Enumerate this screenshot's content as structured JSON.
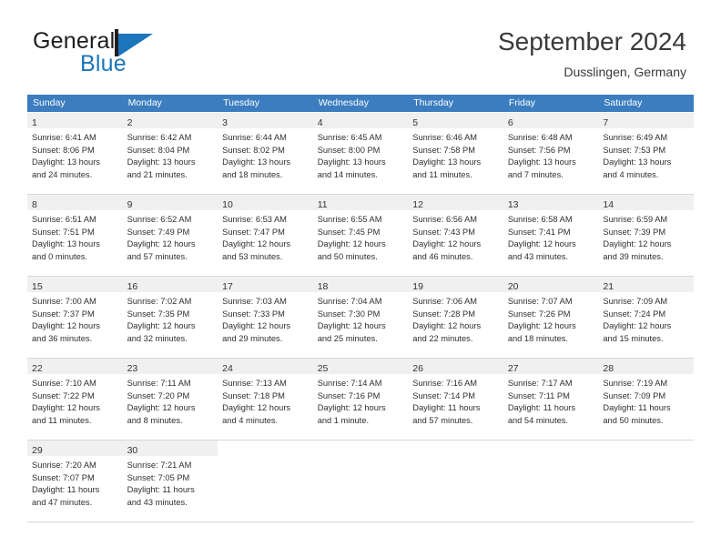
{
  "brand": {
    "name_part1": "General",
    "name_part2": "Blue",
    "mark": "triangle-logo"
  },
  "header": {
    "title": "September 2024",
    "subtitle": "Dusslingen, Germany"
  },
  "colors": {
    "header_blue": "#3b7dbf",
    "brand_blue": "#1b75bb",
    "daynum_band": "#f0f0f0",
    "row_border": "#d7d7d7"
  },
  "weekdays": [
    "Sunday",
    "Monday",
    "Tuesday",
    "Wednesday",
    "Thursday",
    "Friday",
    "Saturday"
  ],
  "weeks": [
    [
      {
        "day": "1",
        "sunrise": "Sunrise: 6:41 AM",
        "sunset": "Sunset: 8:06 PM",
        "daylight1": "Daylight: 13 hours",
        "daylight2": "and 24 minutes."
      },
      {
        "day": "2",
        "sunrise": "Sunrise: 6:42 AM",
        "sunset": "Sunset: 8:04 PM",
        "daylight1": "Daylight: 13 hours",
        "daylight2": "and 21 minutes."
      },
      {
        "day": "3",
        "sunrise": "Sunrise: 6:44 AM",
        "sunset": "Sunset: 8:02 PM",
        "daylight1": "Daylight: 13 hours",
        "daylight2": "and 18 minutes."
      },
      {
        "day": "4",
        "sunrise": "Sunrise: 6:45 AM",
        "sunset": "Sunset: 8:00 PM",
        "daylight1": "Daylight: 13 hours",
        "daylight2": "and 14 minutes."
      },
      {
        "day": "5",
        "sunrise": "Sunrise: 6:46 AM",
        "sunset": "Sunset: 7:58 PM",
        "daylight1": "Daylight: 13 hours",
        "daylight2": "and 11 minutes."
      },
      {
        "day": "6",
        "sunrise": "Sunrise: 6:48 AM",
        "sunset": "Sunset: 7:56 PM",
        "daylight1": "Daylight: 13 hours",
        "daylight2": "and 7 minutes."
      },
      {
        "day": "7",
        "sunrise": "Sunrise: 6:49 AM",
        "sunset": "Sunset: 7:53 PM",
        "daylight1": "Daylight: 13 hours",
        "daylight2": "and 4 minutes."
      }
    ],
    [
      {
        "day": "8",
        "sunrise": "Sunrise: 6:51 AM",
        "sunset": "Sunset: 7:51 PM",
        "daylight1": "Daylight: 13 hours",
        "daylight2": "and 0 minutes."
      },
      {
        "day": "9",
        "sunrise": "Sunrise: 6:52 AM",
        "sunset": "Sunset: 7:49 PM",
        "daylight1": "Daylight: 12 hours",
        "daylight2": "and 57 minutes."
      },
      {
        "day": "10",
        "sunrise": "Sunrise: 6:53 AM",
        "sunset": "Sunset: 7:47 PM",
        "daylight1": "Daylight: 12 hours",
        "daylight2": "and 53 minutes."
      },
      {
        "day": "11",
        "sunrise": "Sunrise: 6:55 AM",
        "sunset": "Sunset: 7:45 PM",
        "daylight1": "Daylight: 12 hours",
        "daylight2": "and 50 minutes."
      },
      {
        "day": "12",
        "sunrise": "Sunrise: 6:56 AM",
        "sunset": "Sunset: 7:43 PM",
        "daylight1": "Daylight: 12 hours",
        "daylight2": "and 46 minutes."
      },
      {
        "day": "13",
        "sunrise": "Sunrise: 6:58 AM",
        "sunset": "Sunset: 7:41 PM",
        "daylight1": "Daylight: 12 hours",
        "daylight2": "and 43 minutes."
      },
      {
        "day": "14",
        "sunrise": "Sunrise: 6:59 AM",
        "sunset": "Sunset: 7:39 PM",
        "daylight1": "Daylight: 12 hours",
        "daylight2": "and 39 minutes."
      }
    ],
    [
      {
        "day": "15",
        "sunrise": "Sunrise: 7:00 AM",
        "sunset": "Sunset: 7:37 PM",
        "daylight1": "Daylight: 12 hours",
        "daylight2": "and 36 minutes."
      },
      {
        "day": "16",
        "sunrise": "Sunrise: 7:02 AM",
        "sunset": "Sunset: 7:35 PM",
        "daylight1": "Daylight: 12 hours",
        "daylight2": "and 32 minutes."
      },
      {
        "day": "17",
        "sunrise": "Sunrise: 7:03 AM",
        "sunset": "Sunset: 7:33 PM",
        "daylight1": "Daylight: 12 hours",
        "daylight2": "and 29 minutes."
      },
      {
        "day": "18",
        "sunrise": "Sunrise: 7:04 AM",
        "sunset": "Sunset: 7:30 PM",
        "daylight1": "Daylight: 12 hours",
        "daylight2": "and 25 minutes."
      },
      {
        "day": "19",
        "sunrise": "Sunrise: 7:06 AM",
        "sunset": "Sunset: 7:28 PM",
        "daylight1": "Daylight: 12 hours",
        "daylight2": "and 22 minutes."
      },
      {
        "day": "20",
        "sunrise": "Sunrise: 7:07 AM",
        "sunset": "Sunset: 7:26 PM",
        "daylight1": "Daylight: 12 hours",
        "daylight2": "and 18 minutes."
      },
      {
        "day": "21",
        "sunrise": "Sunrise: 7:09 AM",
        "sunset": "Sunset: 7:24 PM",
        "daylight1": "Daylight: 12 hours",
        "daylight2": "and 15 minutes."
      }
    ],
    [
      {
        "day": "22",
        "sunrise": "Sunrise: 7:10 AM",
        "sunset": "Sunset: 7:22 PM",
        "daylight1": "Daylight: 12 hours",
        "daylight2": "and 11 minutes."
      },
      {
        "day": "23",
        "sunrise": "Sunrise: 7:11 AM",
        "sunset": "Sunset: 7:20 PM",
        "daylight1": "Daylight: 12 hours",
        "daylight2": "and 8 minutes."
      },
      {
        "day": "24",
        "sunrise": "Sunrise: 7:13 AM",
        "sunset": "Sunset: 7:18 PM",
        "daylight1": "Daylight: 12 hours",
        "daylight2": "and 4 minutes."
      },
      {
        "day": "25",
        "sunrise": "Sunrise: 7:14 AM",
        "sunset": "Sunset: 7:16 PM",
        "daylight1": "Daylight: 12 hours",
        "daylight2": "and 1 minute."
      },
      {
        "day": "26",
        "sunrise": "Sunrise: 7:16 AM",
        "sunset": "Sunset: 7:14 PM",
        "daylight1": "Daylight: 11 hours",
        "daylight2": "and 57 minutes."
      },
      {
        "day": "27",
        "sunrise": "Sunrise: 7:17 AM",
        "sunset": "Sunset: 7:11 PM",
        "daylight1": "Daylight: 11 hours",
        "daylight2": "and 54 minutes."
      },
      {
        "day": "28",
        "sunrise": "Sunrise: 7:19 AM",
        "sunset": "Sunset: 7:09 PM",
        "daylight1": "Daylight: 11 hours",
        "daylight2": "and 50 minutes."
      }
    ],
    [
      {
        "day": "29",
        "sunrise": "Sunrise: 7:20 AM",
        "sunset": "Sunset: 7:07 PM",
        "daylight1": "Daylight: 11 hours",
        "daylight2": "and 47 minutes."
      },
      {
        "day": "30",
        "sunrise": "Sunrise: 7:21 AM",
        "sunset": "Sunset: 7:05 PM",
        "daylight1": "Daylight: 11 hours",
        "daylight2": "and 43 minutes."
      },
      {
        "day": "",
        "sunrise": "",
        "sunset": "",
        "daylight1": "",
        "daylight2": ""
      },
      {
        "day": "",
        "sunrise": "",
        "sunset": "",
        "daylight1": "",
        "daylight2": ""
      },
      {
        "day": "",
        "sunrise": "",
        "sunset": "",
        "daylight1": "",
        "daylight2": ""
      },
      {
        "day": "",
        "sunrise": "",
        "sunset": "",
        "daylight1": "",
        "daylight2": ""
      },
      {
        "day": "",
        "sunrise": "",
        "sunset": "",
        "daylight1": "",
        "daylight2": ""
      }
    ]
  ]
}
